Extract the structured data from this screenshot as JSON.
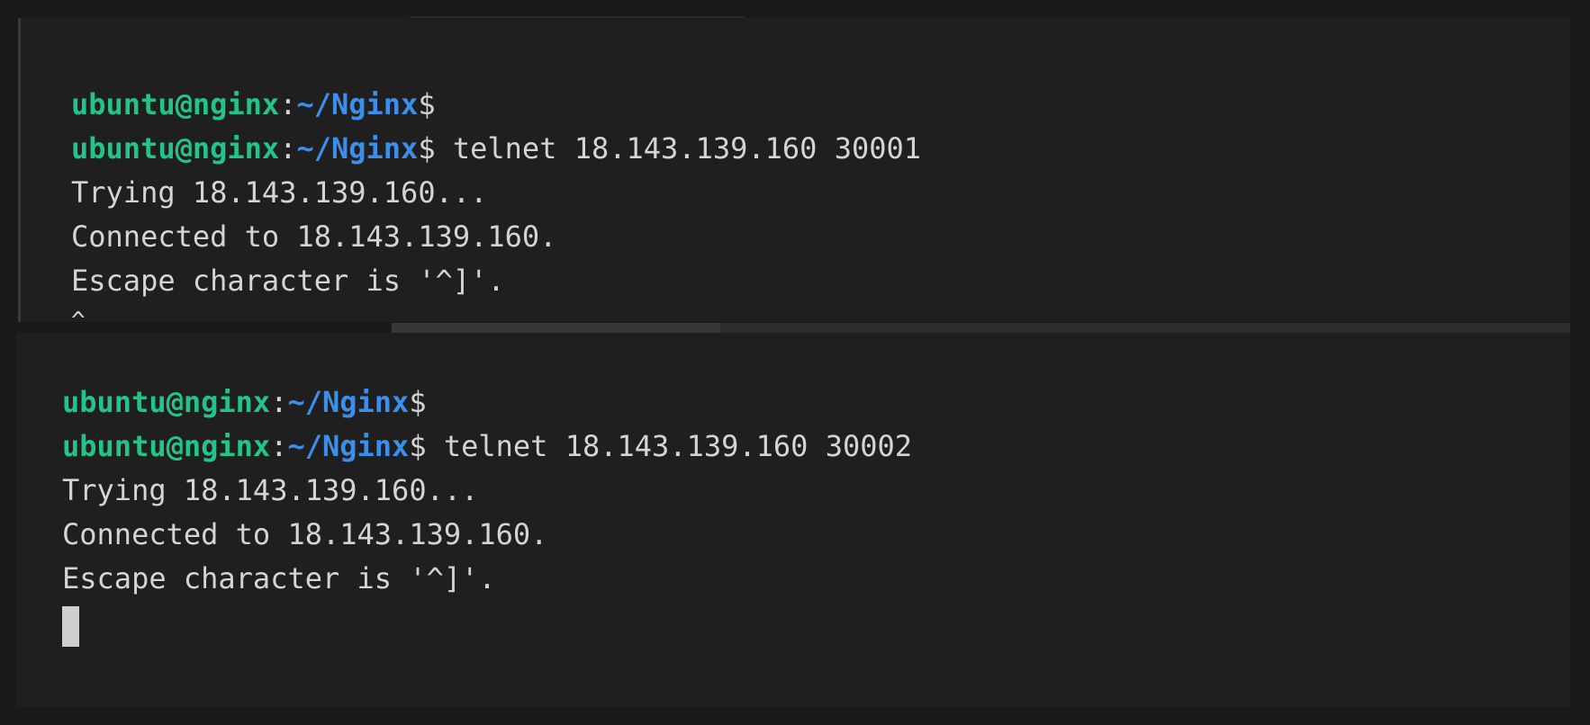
{
  "terminal_top": {
    "lines": [
      {
        "type": "prompt",
        "user_host": "ubuntu@nginx",
        "colon": ":",
        "path": "~/Nginx",
        "dollar": "$",
        "command": ""
      },
      {
        "type": "prompt",
        "user_host": "ubuntu@nginx",
        "colon": ":",
        "path": "~/Nginx",
        "dollar": "$",
        "command": " telnet 18.143.139.160 30001"
      },
      {
        "type": "output",
        "text": "Trying 18.143.139.160..."
      },
      {
        "type": "output",
        "text": "Connected to 18.143.139.160."
      },
      {
        "type": "output",
        "text": "Escape character is '^]'."
      },
      {
        "type": "output",
        "text": "^"
      }
    ]
  },
  "terminal_bottom": {
    "lines": [
      {
        "type": "prompt",
        "user_host": "ubuntu@nginx",
        "colon": ":",
        "path": "~/Nginx",
        "dollar": "$",
        "command": ""
      },
      {
        "type": "prompt",
        "user_host": "ubuntu@nginx",
        "colon": ":",
        "path": "~/Nginx",
        "dollar": "$",
        "command": " telnet 18.143.139.160 30002"
      },
      {
        "type": "output",
        "text": "Trying 18.143.139.160..."
      },
      {
        "type": "output",
        "text": "Connected to 18.143.139.160."
      },
      {
        "type": "output",
        "text": "Escape character is '^]'."
      }
    ]
  },
  "colors": {
    "user_host": "#23c48a",
    "path": "#3b8eea",
    "text": "#d4d4d4",
    "background": "#1f1f1f"
  }
}
